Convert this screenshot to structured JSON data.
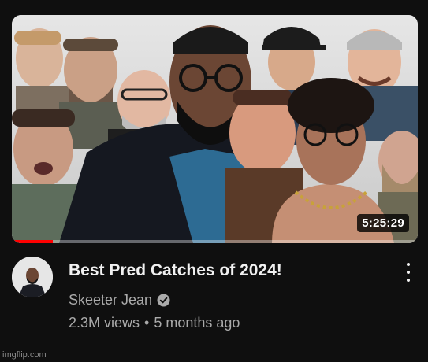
{
  "video": {
    "title": "Best Pred Catches of 2024!",
    "duration": "5:25:29",
    "watch_progress": 0.1,
    "channel": {
      "name": "Skeeter Jean",
      "verified_icon": "verified-check-icon"
    },
    "views": "2.3M views",
    "separator": "•",
    "age": "5 months ago",
    "menu_icon": "more-vertical-icon"
  },
  "watermark": "imgflip.com",
  "colors": {
    "background": "#0f0f0f",
    "title": "#f1f1f1",
    "secondary_text": "#aaaaaa",
    "progress": "#ff0000"
  }
}
